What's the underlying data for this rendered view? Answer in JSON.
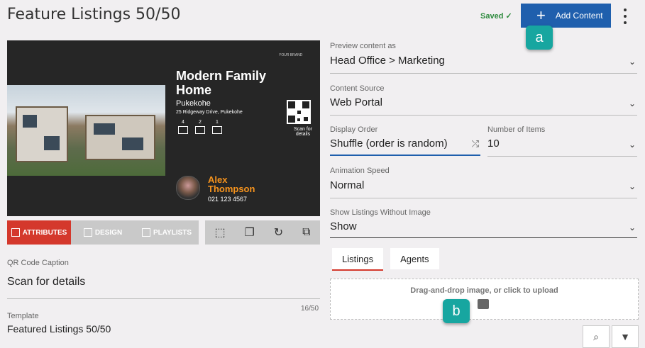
{
  "header": {
    "title": "Feature Listings 50/50",
    "saved_label": "Saved",
    "saved_check": "✓",
    "add_content_label": "Add Content",
    "add_icon": "plus-icon",
    "more_icon": "kebab-menu-icon"
  },
  "callouts": {
    "a": "a",
    "b": "b"
  },
  "preview": {
    "brand": "YOUR BRAND",
    "listing_title": "Modern Family Home",
    "suburb": "Pukekohe",
    "address": "25 Ridgeway Drive, Pukekohe",
    "features": [
      {
        "count": "4",
        "icon": "bed-icon"
      },
      {
        "count": "2",
        "icon": "bath-icon"
      },
      {
        "count": "1",
        "icon": "garage-icon"
      }
    ],
    "scan_text": "Scan for details",
    "agent_first": "Alex",
    "agent_last": "Thompson",
    "agent_phone": "021 123 4567"
  },
  "editor_tabs": [
    {
      "label": "ATTRIBUTES",
      "icon": "edit-icon",
      "active": true
    },
    {
      "label": "DESIGN",
      "icon": "brush-icon",
      "active": false
    },
    {
      "label": "PLAYLISTS",
      "icon": "list-icon",
      "active": false
    }
  ],
  "toolbar_icons": [
    "crop-icon",
    "layers-icon",
    "refresh-icon",
    "screen-cast-icon"
  ],
  "left_form": {
    "qr_caption_label": "QR Code Caption",
    "qr_caption_value": "Scan for details",
    "template_label": "Template",
    "template_counter": "16/50",
    "template_value": "Featured Listings 50/50"
  },
  "right_form": {
    "preview_as_label": "Preview content as",
    "preview_as_value": "Head Office > Marketing",
    "source_label": "Content Source",
    "source_value": "Web Portal",
    "order_label": "Display Order",
    "order_value": "Shuffle (order is random)",
    "items_label": "Number of Items",
    "items_value": "10",
    "speed_label": "Animation Speed",
    "speed_value": "Normal",
    "no_image_label": "Show Listings Without Image",
    "no_image_value": "Show"
  },
  "sub_tabs": [
    "Listings",
    "Agents"
  ],
  "dropzone": {
    "text": "Drag-and-drop image, or click to upload",
    "icon": "image-icon"
  },
  "colors": {
    "accent": "#d4382c",
    "primary": "#1f5fad",
    "callout": "#17a6a0",
    "agent_name": "#f7941d"
  }
}
